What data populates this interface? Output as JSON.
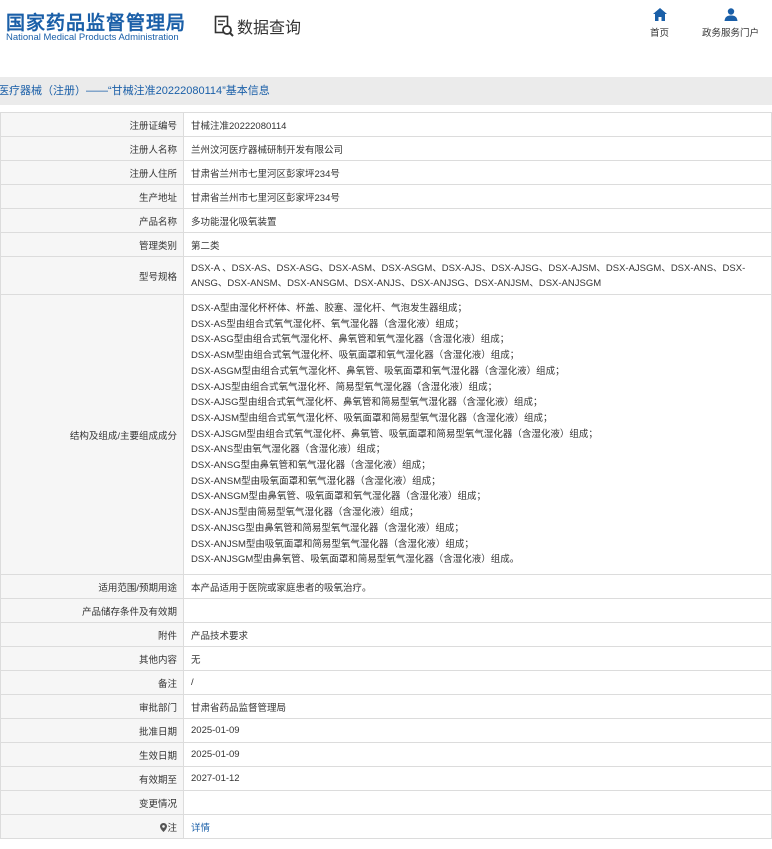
{
  "header": {
    "logo_cn": "国家药品监督管理局",
    "logo_en": "National Medical Products Administration",
    "query_label": "数据查询",
    "nav": [
      {
        "label": "首页",
        "icon": "home-icon"
      },
      {
        "label": "政务服务门户",
        "icon": "user-icon"
      }
    ]
  },
  "breadcrumb": "医疗器械（注册）——“甘械注准20222080114”基本信息",
  "rows": {
    "reg_no": {
      "label": "注册证编号",
      "value": "甘械注准20222080114"
    },
    "registrant": {
      "label": "注册人名称",
      "value": "兰州汶河医疗器械研制开发有限公司"
    },
    "registrant_addr": {
      "label": "注册人住所",
      "value": "甘肃省兰州市七里河区彭家坪234号"
    },
    "prod_addr": {
      "label": "生产地址",
      "value": "甘肃省兰州市七里河区彭家坪234号"
    },
    "product_name": {
      "label": "产品名称",
      "value": "多功能湿化吸氧装置"
    },
    "category": {
      "label": "管理类别",
      "value": "第二类"
    },
    "models": {
      "label": "型号规格",
      "value": "DSX-A 、DSX-AS、DSX-ASG、DSX-ASM、DSX-ASGM、DSX-AJS、DSX-AJSG、DSX-AJSM、DSX-AJSGM、DSX-ANS、DSX-ANSG、DSX-ANSM、DSX-ANSGM、DSX-ANJS、DSX-ANJSG、DSX-ANJSM、DSX-ANJSGM"
    },
    "structure": {
      "label": "结构及组成/主要组成成分",
      "lines": [
        "DSX-A型由湿化杯杯体、杯盖、胶塞、湿化杆、气泡发生器组成；",
        "DSX-AS型由组合式氧气湿化杯、氧气湿化器（含湿化液）组成；",
        "DSX-ASG型由组合式氧气湿化杯、鼻氧管和氧气湿化器（含湿化液）组成；",
        "DSX-ASM型由组合式氧气湿化杯、吸氧面罩和氧气湿化器（含湿化液）组成；",
        "DSX-ASGM型由组合式氧气湿化杯、鼻氧管、吸氧面罩和氧气湿化器（含湿化液）组成；",
        "DSX-AJS型由组合式氧气湿化杯、简易型氧气湿化器（含湿化液）组成；",
        "DSX-AJSG型由组合式氧气湿化杯、鼻氧管和简易型氧气湿化器（含湿化液）组成；",
        "DSX-AJSM型由组合式氧气湿化杯、吸氧面罩和简易型氧气湿化器（含湿化液）组成；",
        "DSX-AJSGM型由组合式氧气湿化杯、鼻氧管、吸氧面罩和简易型氧气湿化器（含湿化液）组成；",
        "DSX-ANS型由氧气湿化器（含湿化液）组成；",
        "DSX-ANSG型由鼻氧管和氧气湿化器（含湿化液）组成；",
        "DSX-ANSM型由吸氧面罩和氧气湿化器（含湿化液）组成；",
        "DSX-ANSGM型由鼻氧管、吸氧面罩和氧气湿化器（含湿化液）组成；",
        "DSX-ANJS型由简易型氧气湿化器（含湿化液）组成；",
        "DSX-ANJSG型由鼻氧管和简易型氧气湿化器（含湿化液）组成；",
        "DSX-ANJSM型由吸氧面罩和简易型氧气湿化器（含湿化液）组成；",
        "DSX-ANJSGM型由鼻氧管、吸氧面罩和简易型氧气湿化器（含湿化液）组成。"
      ]
    },
    "scope": {
      "label": "适用范围/预期用途",
      "value": "本产品适用于医院或家庭患者的吸氧治疗。"
    },
    "storage": {
      "label": "产品储存条件及有效期",
      "value": ""
    },
    "attachment": {
      "label": "附件",
      "value": "产品技术要求"
    },
    "other": {
      "label": "其他内容",
      "value": "无"
    },
    "remark": {
      "label": "备注",
      "value": "/"
    },
    "dept": {
      "label": "审批部门",
      "value": "甘肃省药品监督管理局"
    },
    "approve_date": {
      "label": "批准日期",
      "value": "2025-01-09"
    },
    "effective_date": {
      "label": "生效日期",
      "value": "2025-01-09"
    },
    "expire_date": {
      "label": "有效期至",
      "value": "2027-01-12"
    },
    "change": {
      "label": "变更情况",
      "value": ""
    },
    "note": {
      "label": "注",
      "value": "详情"
    }
  },
  "colors": {
    "brand": "#1a5fa8",
    "label_bg": "#f6f6f6",
    "border": "#dcdcdc",
    "bar_bg": "#ebebeb"
  }
}
